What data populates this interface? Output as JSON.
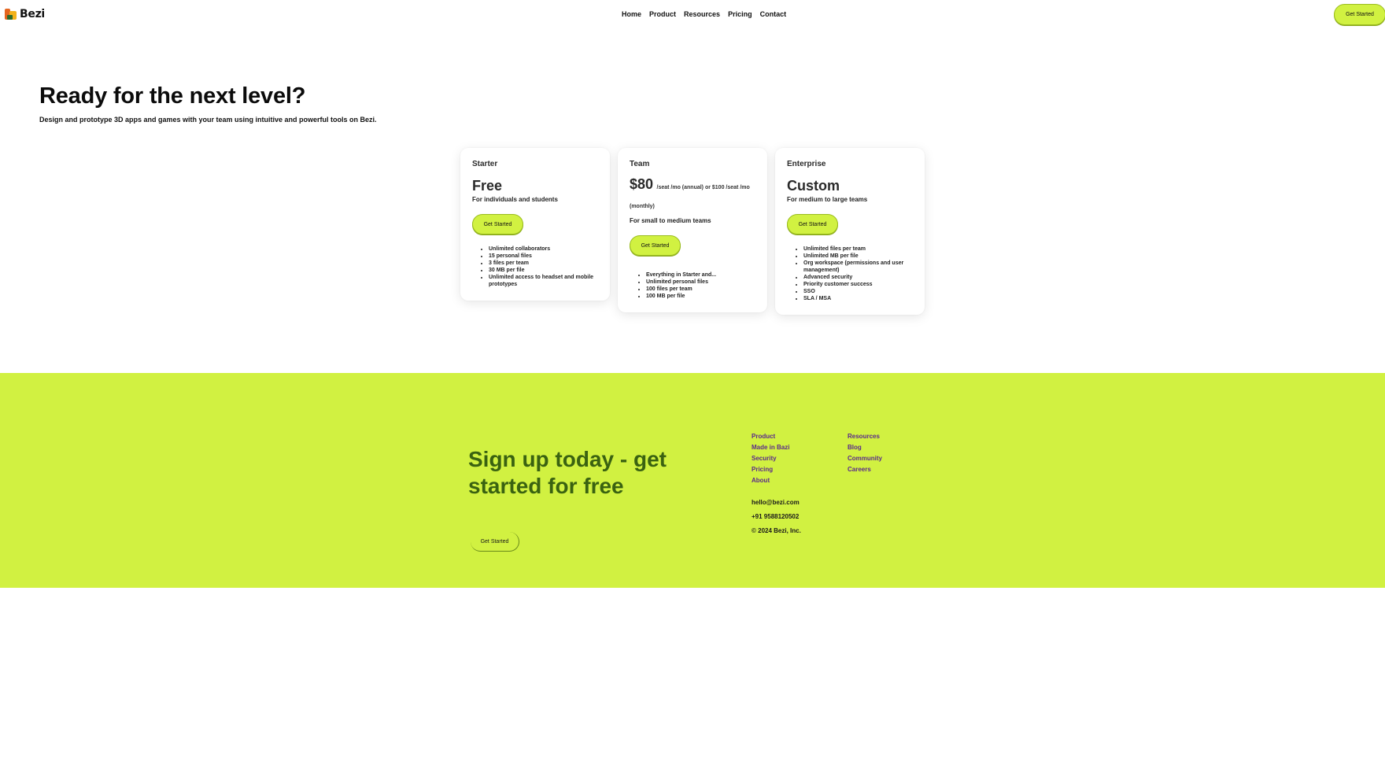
{
  "header": {
    "brand": "Bezi",
    "nav": [
      "Home",
      "Product",
      "Resources",
      "Pricing",
      "Contact"
    ],
    "cta_label": "Get Started"
  },
  "hero": {
    "title": "Ready for the next level?",
    "subtitle": "Design and prototype 3D apps and games with your team using intuitive and powerful tools on Bezi."
  },
  "plans": [
    {
      "name": "Starter",
      "price": "Free",
      "description": "For individuals and students",
      "cta": "Get Started",
      "features": [
        "Unlimited collaborators",
        "15 personal files",
        "3 files per team",
        "30 MB per file",
        "Unlimited access to headset and mobile prototypes"
      ]
    },
    {
      "name": "Team",
      "price": "$80",
      "price_note": "/seat /mo (annual)   or $100 /seat /mo (monthly)",
      "description": "For small to medium teams",
      "cta": "Get Started",
      "features": [
        "Everything in Starter and...",
        "Unlimited personal files",
        "100 files per team",
        "100 MB per file"
      ]
    },
    {
      "name": "Enterprise",
      "price": "Custom",
      "description": "For medium to large teams",
      "cta": "Get Started",
      "features": [
        "Unlimited files per team",
        "Unlimited MB per file",
        "Org workspace (permissions and user management)",
        "Advanced security",
        "Priority customer success",
        "SSO",
        "SLA / MSA"
      ]
    }
  ],
  "footer": {
    "title": "Sign up today - get started for free",
    "cta_label": "Get Started",
    "links_col1": [
      "Product",
      "Made in Bazi",
      "Security",
      "Pricing",
      "About"
    ],
    "links_col2": [
      "Resources",
      "Blog",
      "Community",
      "Careers"
    ],
    "email": "hello@bezi.com",
    "phone": "+91 9588120502",
    "copyright": "© 2024 Bezi, Inc."
  },
  "colors": {
    "accent": "#d1f141",
    "footer_title": "#3a6211",
    "link": "#5a2a8a"
  }
}
